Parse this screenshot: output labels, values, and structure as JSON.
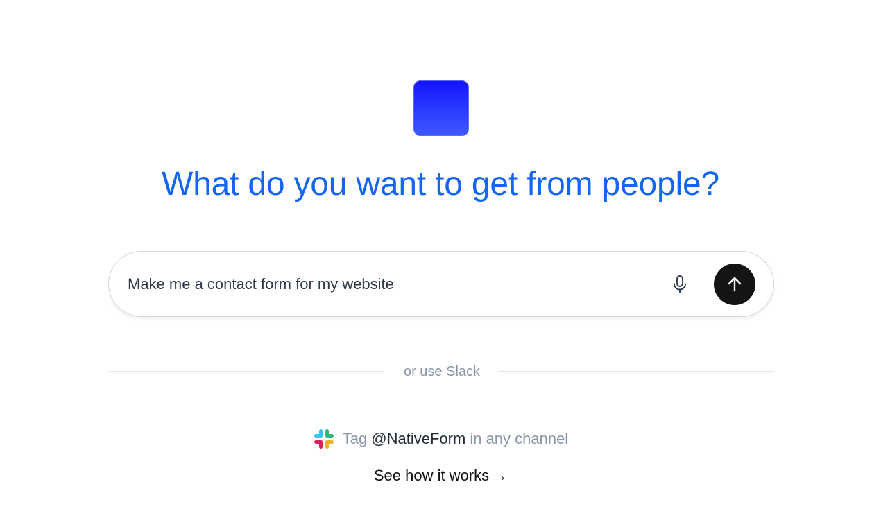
{
  "brand": {
    "logo_colors": [
      "#1414ff",
      "#3d58ff"
    ]
  },
  "headline": "What do you want to get from people?",
  "prompt": {
    "value": "Make me a contact form for my website",
    "mic_icon": "microphone-icon",
    "send_icon": "arrow-up-icon"
  },
  "divider": {
    "label": "or use Slack"
  },
  "slack": {
    "icon": "slack-icon",
    "prefix": "Tag",
    "handle": "@NativeForm",
    "suffix": "in any channel"
  },
  "how_link": {
    "label": "See how it works",
    "arrow": "→"
  },
  "colors": {
    "headline": "#1466f2",
    "send_button": "#141414",
    "muted_text": "#8a97ab"
  }
}
